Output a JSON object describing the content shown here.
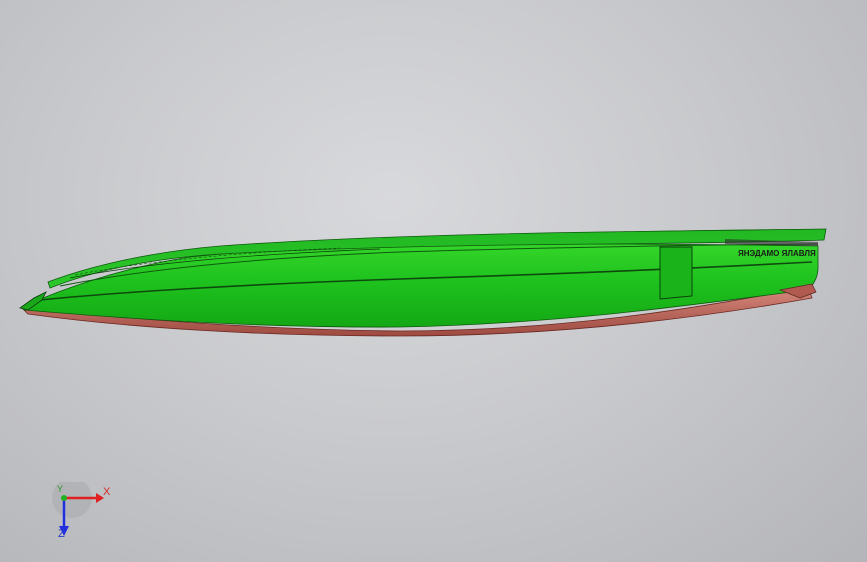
{
  "viewport": {
    "background": "#c9cacd",
    "model": {
      "name": "boat-hull",
      "hull_color": "#1ec21e",
      "bottom_color": "#c06a5e",
      "edge_color": "#1a3a1a",
      "stripe_text": "ЯНЭДАМО ЯЛАВЛЯ"
    }
  },
  "triad": {
    "x_label": "X",
    "y_label": "Y",
    "z_label": "Z",
    "x_color": "#e02020",
    "y_color": "#20b020",
    "z_color": "#2030e0"
  }
}
